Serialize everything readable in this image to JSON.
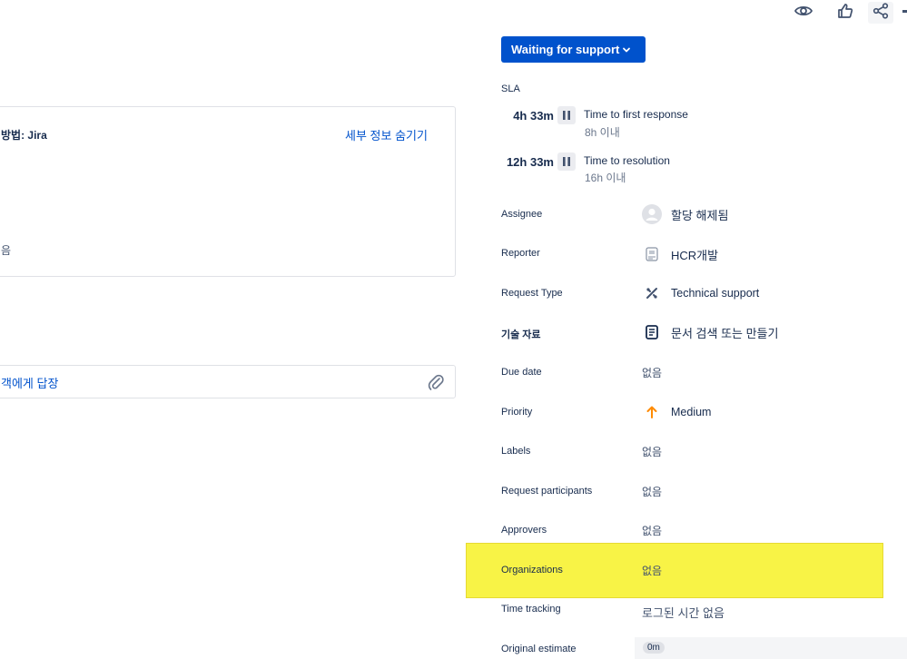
{
  "header": {
    "watch_icon": "eye-icon",
    "like_icon": "thumbs-up-icon",
    "share_icon": "share-icon"
  },
  "left": {
    "detail_title": "방법: Jira",
    "hide_details_link": "세부 정보 숨기기",
    "detail_trailing_text": "음",
    "reply_label": "객에게 답장",
    "attach_icon": "paperclip-icon"
  },
  "status": {
    "label": "Waiting for support",
    "color": "#0052cc"
  },
  "sla": {
    "title": "SLA",
    "items": [
      {
        "time": "4h 33m",
        "name": "Time to first response",
        "target": "8h 이내"
      },
      {
        "time": "12h 33m",
        "name": "Time to resolution",
        "target": "16h 이내"
      }
    ]
  },
  "fields": {
    "assignee": {
      "label": "Assignee",
      "value": "할당 해제됨",
      "icon": "user-avatar-icon"
    },
    "reporter": {
      "label": "Reporter",
      "value": "HCR개발",
      "icon": "reporter-avatar-icon"
    },
    "request_type": {
      "label": "Request Type",
      "value": "Technical support",
      "icon": "tools-icon"
    },
    "knowledge": {
      "label": "기술 자료",
      "value": "문서 검색 또는 만들기",
      "icon": "document-icon"
    },
    "due_date": {
      "label": "Due date",
      "value": "없음"
    },
    "priority": {
      "label": "Priority",
      "value": "Medium",
      "icon": "arrow-up-icon",
      "icon_color": "#ff8b00"
    },
    "labels": {
      "label": "Labels",
      "value": "없음"
    },
    "participants": {
      "label": "Request participants",
      "value": "없음"
    },
    "approvers": {
      "label": "Approvers",
      "value": "없음"
    },
    "organizations": {
      "label": "Organizations",
      "value": "없음"
    },
    "time_tracking": {
      "label": "Time tracking",
      "value": "로그된 시간 없음"
    },
    "original_estimate": {
      "label": "Original estimate",
      "value": "0m"
    }
  },
  "highlight_color": "#f8f33d"
}
